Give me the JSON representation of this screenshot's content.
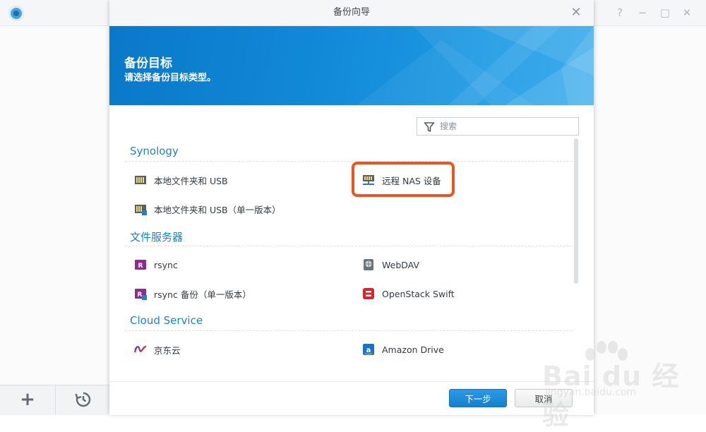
{
  "dialog": {
    "title": "备份向导",
    "banner_title": "备份目标",
    "banner_subtitle": "请选择备份目标类型。"
  },
  "search": {
    "placeholder": "搜索"
  },
  "sections": [
    {
      "header": "Synology",
      "items": [
        {
          "label": "本地文件夹和 USB",
          "icon": "local-folder-usb-icon"
        },
        {
          "label": "远程 NAS 设备",
          "icon": "remote-nas-icon",
          "highlighted": true
        },
        {
          "label": "本地文件夹和 USB（单一版本）",
          "icon": "local-folder-usb-single-icon"
        }
      ]
    },
    {
      "header": "文件服务器",
      "items": [
        {
          "label": "rsync",
          "icon": "rsync-icon"
        },
        {
          "label": "WebDAV",
          "icon": "webdav-icon"
        },
        {
          "label": "rsync 备份（单一版本）",
          "icon": "rsync-single-icon"
        },
        {
          "label": "OpenStack Swift",
          "icon": "openstack-swift-icon"
        }
      ]
    },
    {
      "header": "Cloud Service",
      "items": [
        {
          "label": "京东云",
          "icon": "jdcloud-icon"
        },
        {
          "label": "Amazon Drive",
          "icon": "amazon-drive-icon"
        }
      ]
    }
  ],
  "footer": {
    "next_label": "下一步",
    "cancel_label": "取消"
  },
  "watermark": {
    "text": "Bai du 经验",
    "sub": "jingyan.baidu.com"
  },
  "colors": {
    "accent": "#1d82c9",
    "highlight": "#f0541e",
    "banner": "#128ad8"
  }
}
